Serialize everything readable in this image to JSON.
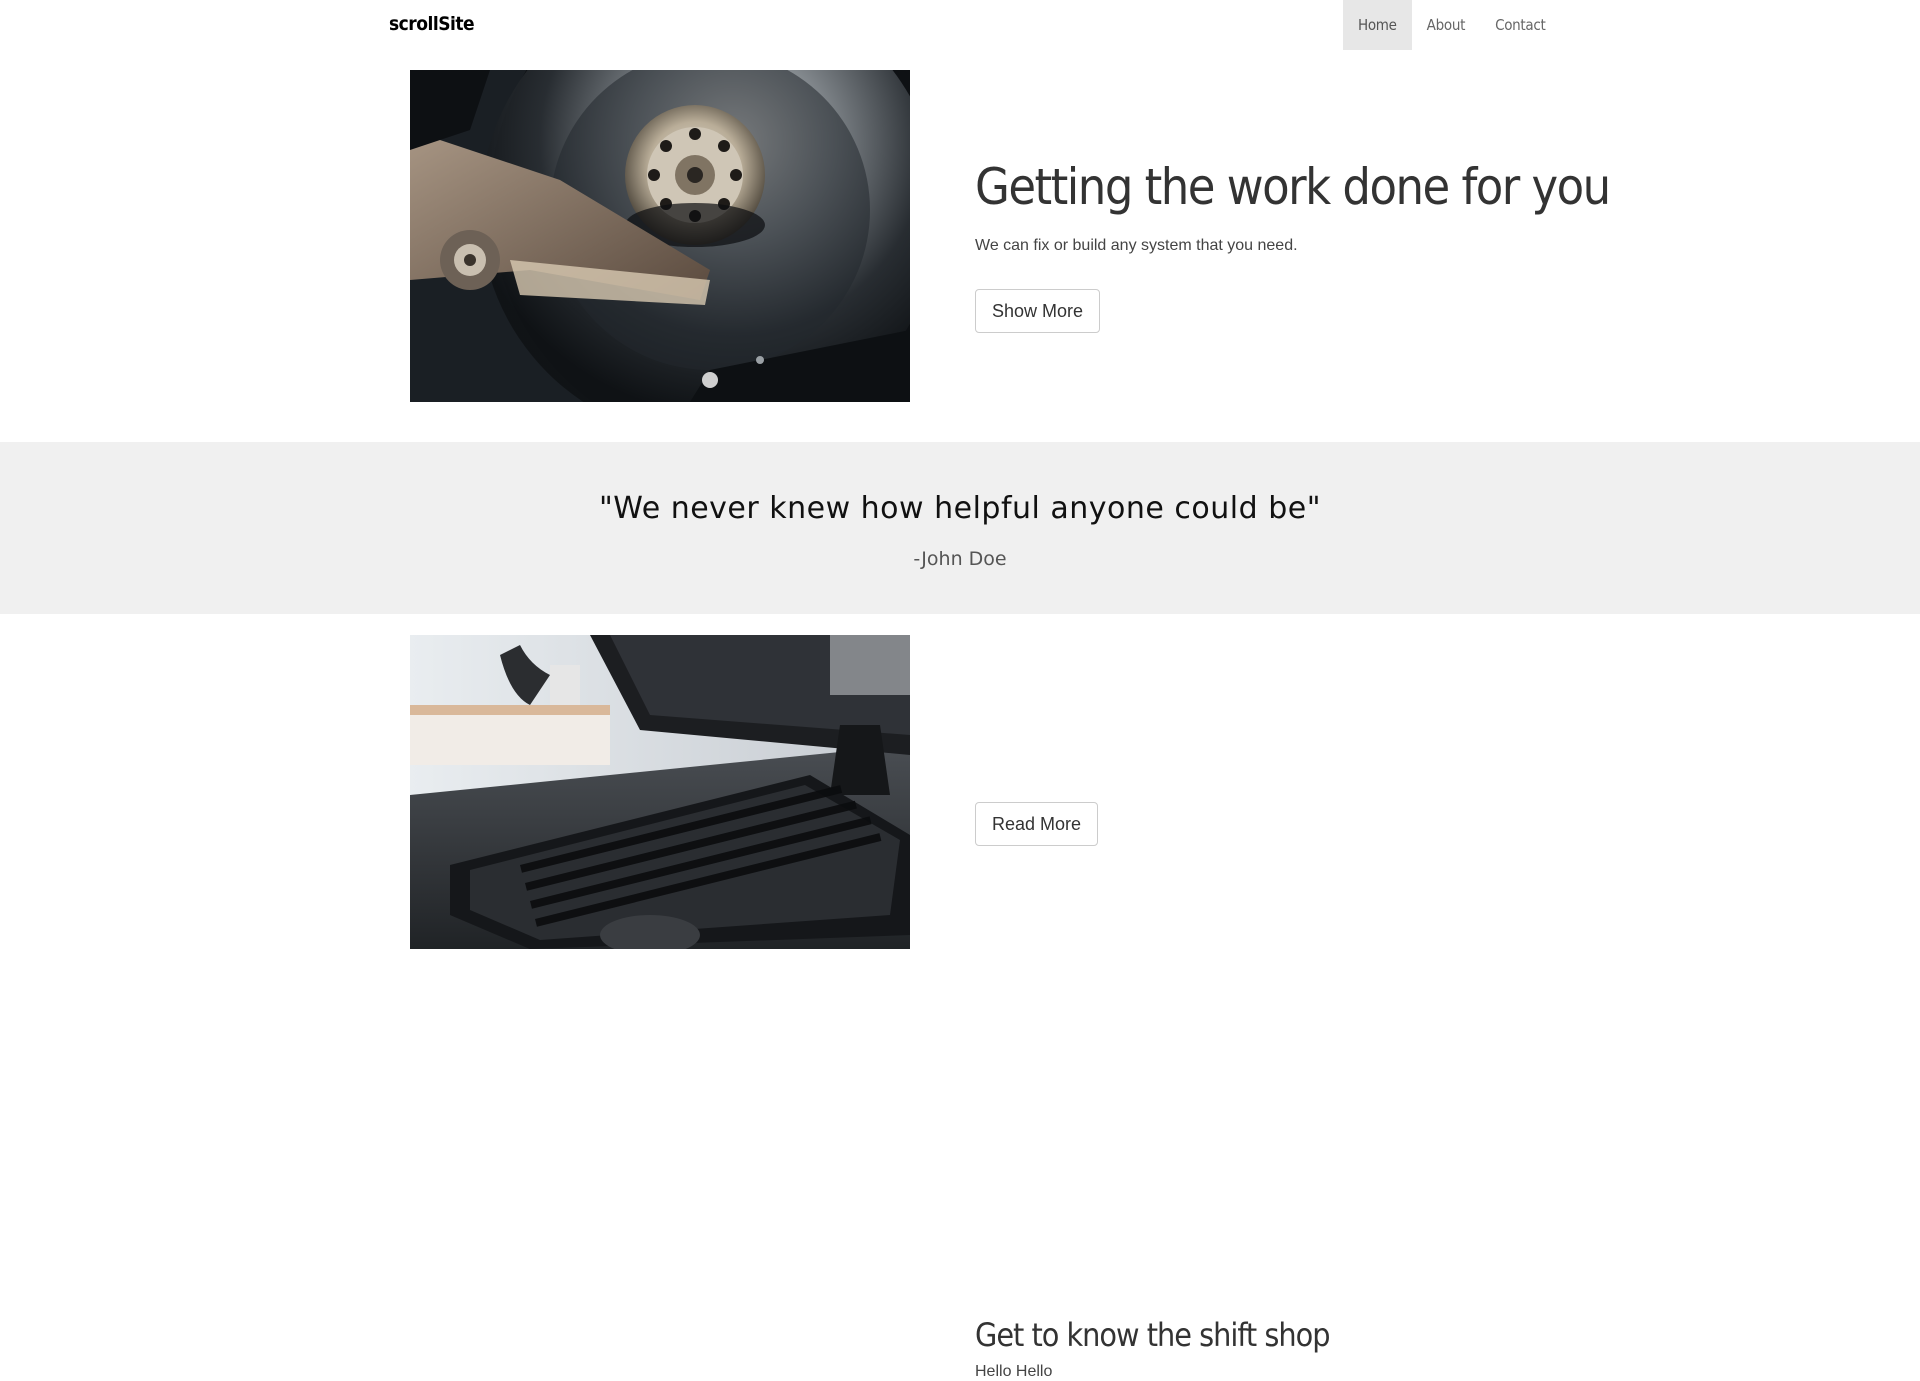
{
  "navbar": {
    "brand": "scrollSite",
    "items": [
      {
        "label": "Home",
        "active": true
      },
      {
        "label": "About",
        "active": false
      },
      {
        "label": "Contact",
        "active": false
      }
    ]
  },
  "hero": {
    "title": "Getting the work done for you",
    "text": "We can fix or build any system that you need.",
    "button_label": "Show More",
    "image_icon": "hard-drive-photo"
  },
  "quote": {
    "text": "\"We never knew how helpful anyone could be\"",
    "author": "-John Doe",
    "background": "#f0f0f0"
  },
  "shop": {
    "title": "Get to know the shift shop",
    "text": "Hello Hello",
    "button_label": "Read More",
    "image_icon": "keyboard-photo"
  }
}
